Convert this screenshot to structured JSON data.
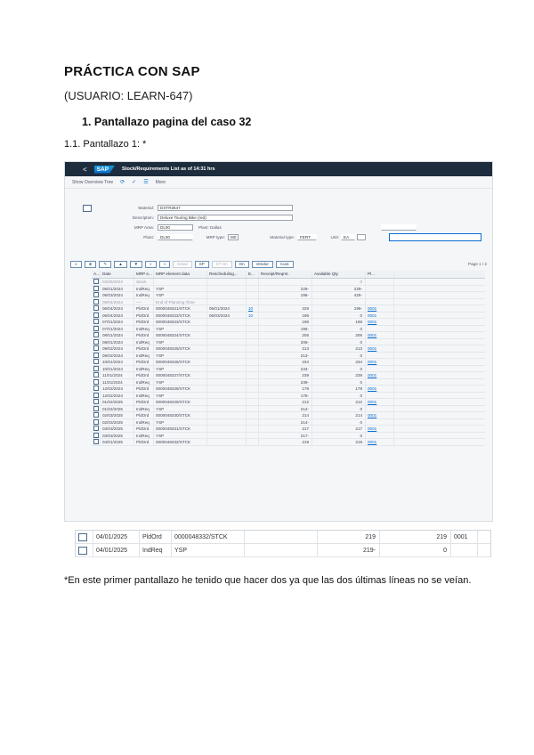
{
  "doc": {
    "title": "PRÁCTICA CON SAP",
    "user": "(USUARIO: LEARN-647)",
    "h1": "1.  Pantallazo pagina del caso 32",
    "sub": "1.1. Pantallazo 1: *",
    "note": "*En este primer pantallazo he tenido que hacer dos ya que las dos últimas líneas no se veían."
  },
  "sap": {
    "app_title": "Stock/Requirements List as of 14:31 hrs",
    "back_label": "<",
    "logo": "SAP",
    "toolbar": [
      "Show Overview Tree",
      "More"
    ],
    "header": {
      "material_label": "Material:",
      "material_value": "DXTR3647",
      "description_label": "Description:",
      "description_value": "Deluxe Touring Bike (red)",
      "mrp_area_label": "MRP Area:",
      "mrp_area_value": "DL00",
      "plant_label": "Plant: Dallas",
      "plant_field_label": "Plant:",
      "plant_value": "DL00",
      "mrp_type_label": "MRP type:",
      "mrp_type_value": "M0",
      "material_type_label": "Material type:",
      "material_type_value": "FERT",
      "unit_label": "Unit:",
      "unit_value": "EA"
    },
    "grid_buttons": [
      "Detail",
      "SP",
      "ST On",
      "On",
      "Vendor",
      "Cust."
    ],
    "pager": "Page      1  / 2",
    "columns": [
      "A...",
      "Date",
      "MRP e...",
      "MRP element data",
      "Rescheduling...",
      "E...",
      "Receipt/Reqmt.",
      "Available Qty",
      "Pl..."
    ],
    "rows": [
      {
        "date": "03/26/2024",
        "mrp": "Stock",
        "el": "",
        "res": "",
        "e": "",
        "rec": "",
        "av": "0",
        "pl": "",
        "grey": true
      },
      {
        "date": "05/01/2024",
        "mrp": "IndReq",
        "el": "YSP",
        "res": "",
        "e": "",
        "rec": "229-",
        "av": "229-",
        "pl": ""
      },
      {
        "date": "06/03/2024",
        "mrp": "IndReq",
        "el": "YSP",
        "res": "",
        "e": "",
        "rec": "196-",
        "av": "425-",
        "pl": ""
      },
      {
        "date": "06/04/2024",
        "mrp": "----",
        "el": "End of Planning Time",
        "res": "",
        "e": "",
        "rec": "",
        "av": "",
        "pl": "",
        "grey": true
      },
      {
        "date": "06/04/2024",
        "mrp": "PldOrd",
        "el": "0000048321/STCK",
        "res": "05/01/2024",
        "e": "10",
        "rec": "229",
        "av": "196-",
        "pl": "0001"
      },
      {
        "date": "06/04/2024",
        "mrp": "PldOrd",
        "el": "0000048322/STCK",
        "res": "06/03/2024",
        "e": "10",
        "rec": "196",
        "av": "0",
        "pl": "0001"
      },
      {
        "date": "07/01/2024",
        "mrp": "PldOrd",
        "el": "0000048323/STCK",
        "res": "",
        "e": "",
        "rec": "196",
        "av": "196",
        "pl": "0001"
      },
      {
        "date": "07/01/2024",
        "mrp": "IndReq",
        "el": "YSP",
        "res": "",
        "e": "",
        "rec": "196-",
        "av": "0",
        "pl": ""
      },
      {
        "date": "08/01/2024",
        "mrp": "PldOrd",
        "el": "0000048324/STCK",
        "res": "",
        "e": "",
        "rec": "206",
        "av": "206",
        "pl": "0001"
      },
      {
        "date": "08/01/2024",
        "mrp": "IndReq",
        "el": "YSP",
        "res": "",
        "e": "",
        "rec": "206-",
        "av": "0",
        "pl": ""
      },
      {
        "date": "09/02/2024",
        "mrp": "PldOrd",
        "el": "0000048325/STCK",
        "res": "",
        "e": "",
        "rec": "213",
        "av": "213",
        "pl": "0001"
      },
      {
        "date": "09/02/2024",
        "mrp": "IndReq",
        "el": "YSP",
        "res": "",
        "e": "",
        "rec": "213-",
        "av": "0",
        "pl": ""
      },
      {
        "date": "10/01/2024",
        "mrp": "PldOrd",
        "el": "0000048326/STCK",
        "res": "",
        "e": "",
        "rec": "234",
        "av": "234",
        "pl": "0001"
      },
      {
        "date": "10/01/2024",
        "mrp": "IndReq",
        "el": "YSP",
        "res": "",
        "e": "",
        "rec": "234-",
        "av": "0",
        "pl": ""
      },
      {
        "date": "11/01/2024",
        "mrp": "PldOrd",
        "el": "0000048327/STCK",
        "res": "",
        "e": "",
        "rec": "239",
        "av": "239",
        "pl": "0001"
      },
      {
        "date": "11/01/2024",
        "mrp": "IndReq",
        "el": "YSP",
        "res": "",
        "e": "",
        "rec": "239-",
        "av": "0",
        "pl": ""
      },
      {
        "date": "12/02/2024",
        "mrp": "PldOrd",
        "el": "0000048328/STCK",
        "res": "",
        "e": "",
        "rec": "178",
        "av": "178",
        "pl": "0001"
      },
      {
        "date": "12/02/2024",
        "mrp": "IndReq",
        "el": "YSP",
        "res": "",
        "e": "",
        "rec": "178-",
        "av": "0",
        "pl": ""
      },
      {
        "date": "01/02/2025",
        "mrp": "PldOrd",
        "el": "0000048329/STCK",
        "res": "",
        "e": "",
        "rec": "212",
        "av": "212",
        "pl": "0001"
      },
      {
        "date": "01/02/2025",
        "mrp": "IndReq",
        "el": "YSP",
        "res": "",
        "e": "",
        "rec": "212-",
        "av": "0",
        "pl": ""
      },
      {
        "date": "02/03/2025",
        "mrp": "PldOrd",
        "el": "0000048330/STCK",
        "res": "",
        "e": "",
        "rec": "214",
        "av": "214",
        "pl": "0001"
      },
      {
        "date": "02/03/2025",
        "mrp": "IndReq",
        "el": "YSP",
        "res": "",
        "e": "",
        "rec": "214-",
        "av": "0",
        "pl": ""
      },
      {
        "date": "03/03/2025",
        "mrp": "PldOrd",
        "el": "0000048331/STCK",
        "res": "",
        "e": "",
        "rec": "217",
        "av": "217",
        "pl": "0001"
      },
      {
        "date": "03/03/2025",
        "mrp": "IndReq",
        "el": "YSP",
        "res": "",
        "e": "",
        "rec": "217-",
        "av": "0",
        "pl": ""
      },
      {
        "date": "04/01/2025",
        "mrp": "PldOrd",
        "el": "0000048332/STCK",
        "res": "",
        "e": "",
        "rec": "219",
        "av": "219",
        "pl": "0001"
      }
    ]
  },
  "shot2": {
    "rows": [
      {
        "date": "04/01/2025",
        "mrp": "PldOrd",
        "el": "0000048332/STCK",
        "res": "",
        "rec": "219",
        "av": "219",
        "pl": "0001"
      },
      {
        "date": "04/01/2025",
        "mrp": "IndReq",
        "el": "YSP",
        "res": "",
        "rec": "219-",
        "av": "0",
        "pl": ""
      }
    ]
  }
}
